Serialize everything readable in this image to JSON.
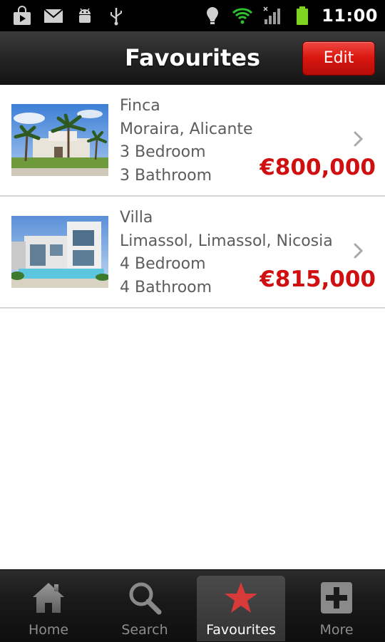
{
  "status_bar": {
    "icons_left": [
      "shopping-bag-icon",
      "gmail-icon",
      "android-icon",
      "usb-icon"
    ],
    "icons_right": [
      "location-icon",
      "wifi-icon",
      "signal-icon",
      "battery-icon"
    ],
    "time": "11:00"
  },
  "header": {
    "title": "Favourites",
    "edit_label": "Edit"
  },
  "favourites": [
    {
      "type": "Finca",
      "location": "Moraira, Alicante",
      "bedrooms": "3 Bedroom",
      "bathrooms": "3 Bathroom",
      "price": "€800,000"
    },
    {
      "type": "Villa",
      "location": "Limassol, Limassol, Nicosia",
      "bedrooms": "4 Bedroom",
      "bathrooms": "4 Bathroom",
      "price": "€815,000"
    }
  ],
  "tabs": [
    {
      "label": "Home",
      "icon": "home-icon",
      "active": false
    },
    {
      "label": "Search",
      "icon": "search-icon",
      "active": false
    },
    {
      "label": "Favourites",
      "icon": "star-icon",
      "active": true
    },
    {
      "label": "More",
      "icon": "plus-icon",
      "active": false
    }
  ],
  "colors": {
    "accent_red": "#d01010",
    "edit_button": "#d9150f",
    "active_star": "#d83a3a"
  }
}
